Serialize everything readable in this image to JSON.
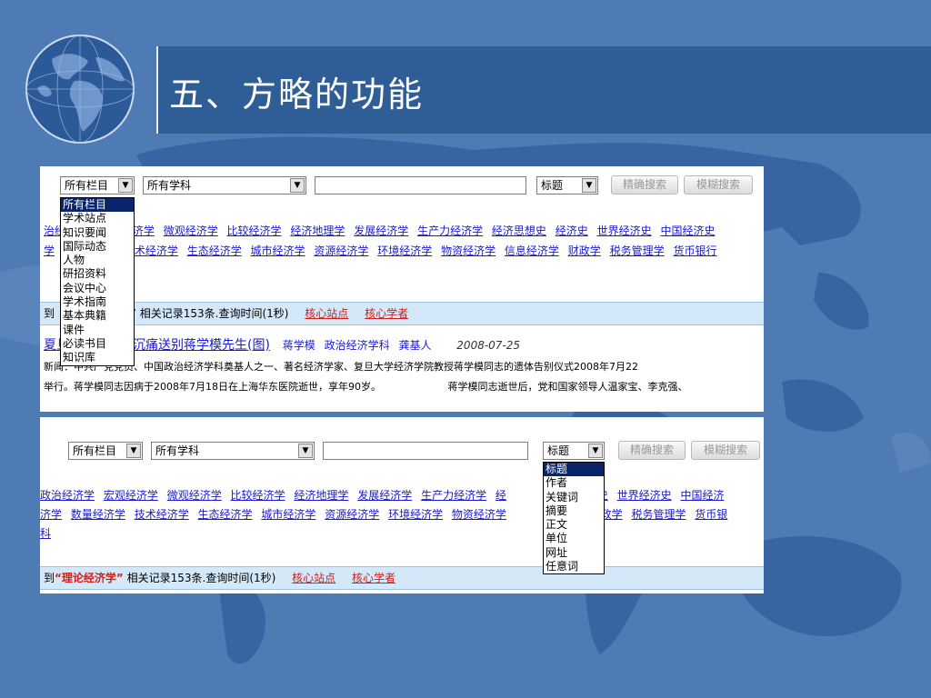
{
  "slide_title": "五、方略的功能",
  "shot1": {
    "column_select": "所有栏目",
    "subject_select": "所有学科",
    "field_select": "标题",
    "exact_button": "精确搜索",
    "fuzzy_button": "模糊搜索",
    "link_row1": [
      "治经",
      "济学",
      "微观经济学",
      "比较经济学",
      "经济地理学",
      "发展经济学",
      "生产力经济学",
      "经济思想史",
      "经济史",
      "世界经济史",
      "中国经济史"
    ],
    "link_row2": [
      "学",
      "技术经济学",
      "生态经济学",
      "城市经济学",
      "资源经济学",
      "环境经济学",
      "物资经济学",
      "信息经济学",
      "财政学",
      "税务管理学",
      "货币银行"
    ],
    "bar_prefix": "到",
    "bar_quote_close": "”",
    "bar_text": "相关记录153条.查询时间(1秒)",
    "bar_link1": "核心站点",
    "bar_link2": "核心学者",
    "result_title_prefix": "夏旦",
    "result_title": "沉痛送别蒋学模先生(图)",
    "result_author": "蒋学模",
    "result_subject": "政治经济学科",
    "result_editor": "龚基人",
    "result_date": "2008-07-25",
    "snippet1": "新闻：中共产党党员、中国政治经济学科奠基人之一、著名经济学家、复旦大学经济学院教授蒋学模同志的遗体告别仪式2008年7月22",
    "snippet2": "举行。蒋学模同志因病于2008年7月18日在上海华东医院逝世，享年90岁。",
    "snippet2b": "蒋学模同志逝世后，党和国家领导人温家宝、李克强、",
    "dropdown": [
      "所有栏目",
      "学术站点",
      "知识要闻",
      "国际动态",
      "人物",
      "研招资料",
      "会议中心",
      "学术指南",
      "基本典籍",
      "课件",
      "必读书目",
      "知识库"
    ]
  },
  "shot2": {
    "column_select": "所有栏目",
    "subject_select": "所有学科",
    "field_select": "标题",
    "exact_button": "精确搜索",
    "fuzzy_button": "模糊搜索",
    "link_row1": [
      "政治经济学",
      "宏观经济学",
      "微观经济学",
      "比较经济学",
      "经济地理学",
      "发展经济学",
      "生产力经济学",
      "经",
      "济史",
      "世界经济史",
      "中国经济"
    ],
    "link_row2": [
      "济学",
      "数量经济学",
      "技术经济学",
      "生态经济学",
      "城市经济学",
      "资源经济学",
      "环境经济学",
      "物资经济学",
      "学",
      "财政学",
      "税务管理学",
      "货币银"
    ],
    "link_row3": "科",
    "bar_prefix": "到",
    "bar_keyword": "“理论经济学”",
    "bar_text": "相关记录153条.查询时间(1秒)",
    "bar_link1": "核心站点",
    "bar_link2": "核心学者",
    "dropdown": [
      "标题",
      "作者",
      "关键词",
      "摘要",
      "正文",
      "单位",
      "网址",
      "任意词"
    ]
  }
}
